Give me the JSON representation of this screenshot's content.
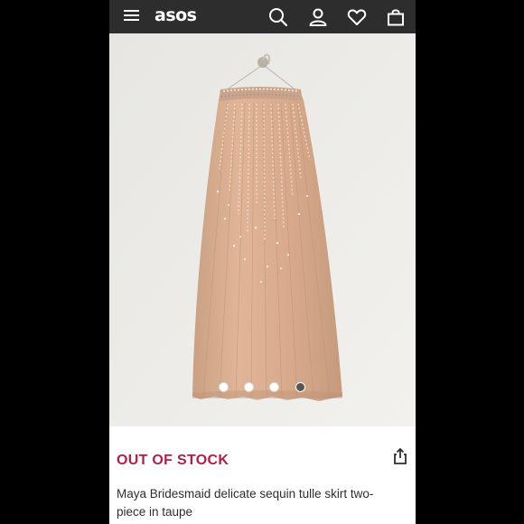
{
  "header": {
    "logo": "asos",
    "icons": [
      "menu-icon",
      "search-icon",
      "account-icon",
      "heart-icon",
      "bag-icon"
    ]
  },
  "gallery": {
    "image": "maxi-skirt-photo",
    "dot_count": 4,
    "active_index": 3
  },
  "product": {
    "stock_status": "OUT OF STOCK",
    "title": "Maya Bridesmaid delicate sequin tulle skirt two-piece in taupe"
  },
  "colors": {
    "header_bg": "#2d2d2d",
    "status_red": "#b51d46",
    "skirt": "#d9a98a"
  }
}
